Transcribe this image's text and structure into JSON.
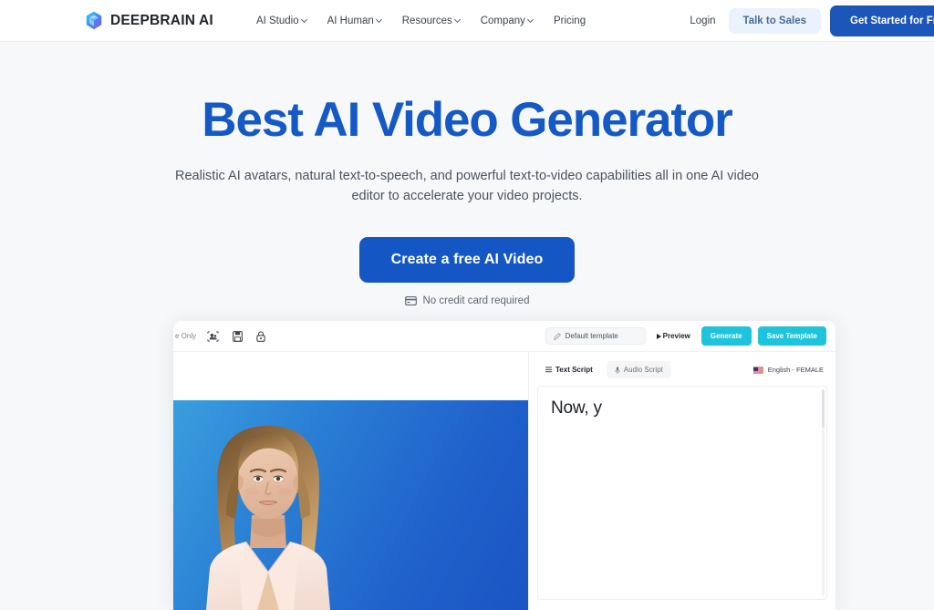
{
  "brand": {
    "name_main": "DEEPBRAIN",
    "name_accent": "AI",
    "logo_icon": "cube-logo-icon"
  },
  "header": {
    "nav": [
      {
        "label": "AI Studio",
        "has_caret": true
      },
      {
        "label": "AI Human",
        "has_caret": true
      },
      {
        "label": "Resources",
        "has_caret": true
      },
      {
        "label": "Company",
        "has_caret": true
      },
      {
        "label": "Pricing",
        "has_caret": false
      }
    ],
    "login_label": "Login",
    "talk_to_sales_label": "Talk to Sales",
    "get_started_label": "Get Started for Free"
  },
  "hero": {
    "title": "Best AI Video Generator",
    "subtitle": "Realistic AI avatars, natural text-to-speech, and powerful text-to-video capabilities all in one AI video editor to accelerate your video projects.",
    "cta_label": "Create a free AI Video",
    "no_credit_card": "No credit card required",
    "no_credit_card_icon": "credit-card-icon"
  },
  "app": {
    "toolbar": {
      "cut_label": "e Only",
      "icons": [
        "avatar-group-icon",
        "save-icon",
        "lock-icon"
      ],
      "template_value": "Default template",
      "template_icon": "pencil-icon",
      "preview_label": "Preview",
      "preview_icon": "play-icon",
      "generate_label": "Generate",
      "save_template_label": "Save Template"
    },
    "script": {
      "tabs": [
        {
          "label": "Text Script",
          "icon": "list-icon",
          "active": true
        },
        {
          "label": "Audio Script",
          "icon": "microphone-icon",
          "active": false
        }
      ],
      "voice_label": "English - FEMALE",
      "voice_flag_icon": "us-flag-icon",
      "text_value": "Now, y"
    },
    "video": {
      "avatar_alt": "ai-presenter-avatar"
    }
  },
  "colors": {
    "page_bg": "#f7f8fa",
    "hero_blue": "#1559c6",
    "cta_blue": "#1456c4",
    "header_cta_blue": "#1b56b8",
    "sales_bg": "#e9f2fd",
    "cyan": "#1ec4db",
    "stage_blue": "#2a7fd4"
  }
}
